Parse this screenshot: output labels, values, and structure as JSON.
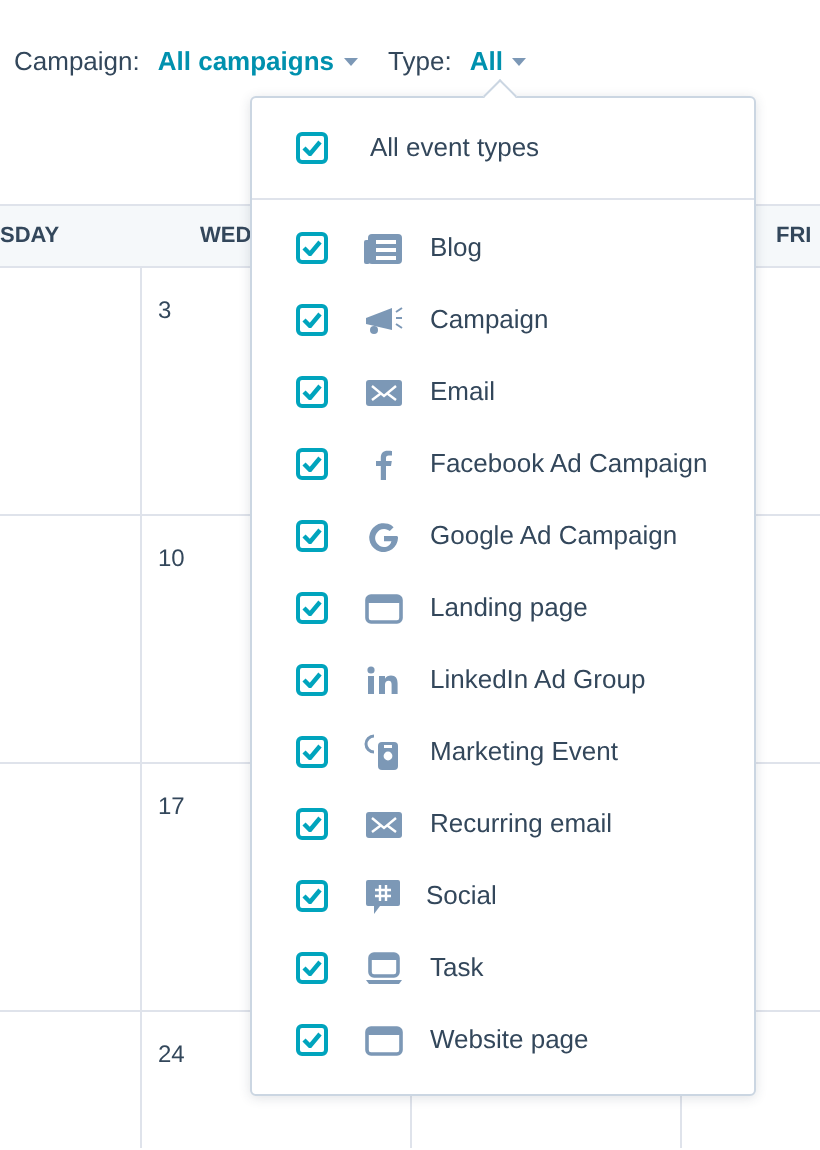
{
  "filters": [
    {
      "label": "Campaign:",
      "value": "All campaigns"
    },
    {
      "label": "Type:",
      "value": "All"
    }
  ],
  "calendar": {
    "columns": [
      "SDAY",
      "WED",
      "FRI"
    ],
    "weeks": [
      {
        "day": "3"
      },
      {
        "day": "10"
      },
      {
        "day": "17"
      },
      {
        "day": "24"
      }
    ]
  },
  "type_menu": {
    "all_option": {
      "label": "All event types",
      "checked": true
    },
    "options": [
      {
        "kind": "blog",
        "label": "Blog",
        "checked": true
      },
      {
        "kind": "campaign",
        "label": "Campaign",
        "checked": true
      },
      {
        "kind": "email",
        "label": "Email",
        "checked": true
      },
      {
        "kind": "facebook",
        "label": "Facebook Ad Campaign",
        "checked": true
      },
      {
        "kind": "google",
        "label": "Google Ad Campaign",
        "checked": true
      },
      {
        "kind": "landing",
        "label": "Landing page",
        "checked": true
      },
      {
        "kind": "linkedin",
        "label": "LinkedIn Ad Group",
        "checked": true
      },
      {
        "kind": "event",
        "label": "Marketing Event",
        "checked": true
      },
      {
        "kind": "email",
        "label": "Recurring email",
        "checked": true
      },
      {
        "kind": "social",
        "label": "Social",
        "checked": true
      },
      {
        "kind": "task",
        "label": "Task",
        "checked": true
      },
      {
        "kind": "landing",
        "label": "Website page",
        "checked": true
      }
    ]
  }
}
